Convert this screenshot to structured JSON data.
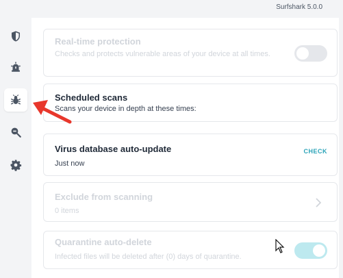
{
  "app": {
    "title": "Surfshark 5.0.0"
  },
  "sidebar": {
    "items": [
      {
        "icon": "shield-icon",
        "active": false
      },
      {
        "icon": "alert-icon",
        "active": false
      },
      {
        "icon": "bug-icon",
        "active": true
      },
      {
        "icon": "search-icon",
        "active": false
      },
      {
        "icon": "gear-icon",
        "active": false
      }
    ]
  },
  "settings": {
    "realtime": {
      "title": "Real-time protection",
      "description": "Checks and protects vulnerable areas of your device at all times.",
      "enabled": false,
      "disabled": true
    },
    "scheduled": {
      "title": "Scheduled scans",
      "description": "Scans your device in depth at these times:"
    },
    "virusdb": {
      "title": "Virus database auto-update",
      "status": "Just now",
      "action": "CHECK"
    },
    "exclude": {
      "title": "Exclude from scanning",
      "count": "0 items",
      "disabled": true
    },
    "quarantine": {
      "title": "Quarantine auto-delete",
      "description": "Infected files will be deleted after (0) days of quarantine.",
      "enabled": true,
      "disabled": true
    }
  },
  "colors": {
    "accent": "#2aa3b8",
    "toggle_on_disabled": "#bde9ef",
    "toggle_off": "#d1d5db",
    "annotation_arrow": "#e8372c"
  }
}
